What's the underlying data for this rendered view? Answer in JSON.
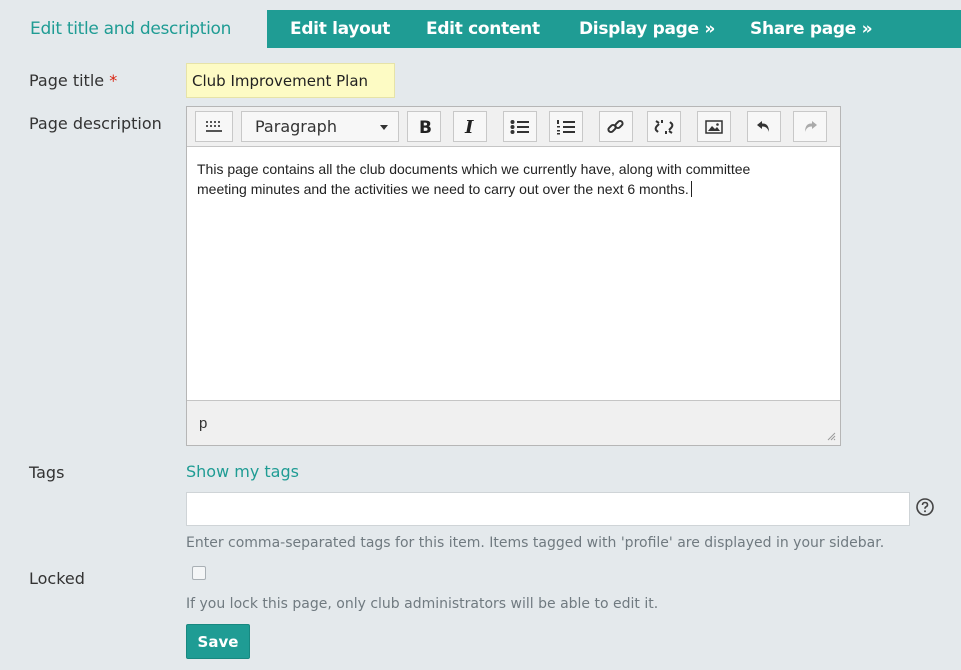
{
  "tabs": [
    {
      "label": "Edit title and description",
      "active": true
    },
    {
      "label": "Edit layout"
    },
    {
      "label": "Edit content"
    },
    {
      "label": "Display page »"
    },
    {
      "label": "Share page »"
    }
  ],
  "form": {
    "page_title_label": "Page title",
    "required_marker": "*",
    "page_title_value": "Club Improvement Plan",
    "page_description_label": "Page description",
    "tags_label": "Tags",
    "show_tags_link": "Show my tags",
    "tags_value": "",
    "tags_hint": "Enter comma-separated tags for this item. Items tagged with 'profile' are displayed in your sidebar.",
    "locked_label": "Locked",
    "locked_hint": "If you lock this page, only club administrators will be able to edit it.",
    "save_label": "Save"
  },
  "editor": {
    "format_value": "Paragraph",
    "content_line1": "This page contains all the club documents which we currently have, along with committee",
    "content_line2": "meeting minutes and the activities we need to carry out over the next 6 months.",
    "status_path": "p"
  },
  "colors": {
    "accent": "#1f9c94",
    "background": "#e4e9ec",
    "required": "#d9230f",
    "title_input_bg": "#fdfbc4"
  }
}
